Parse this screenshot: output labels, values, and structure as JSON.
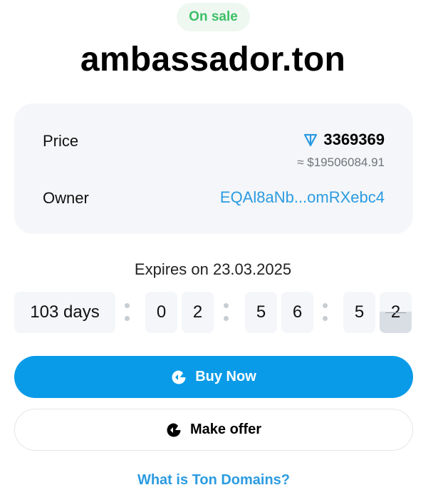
{
  "badge": {
    "label": "On sale",
    "color": "#3dbf67"
  },
  "domain": {
    "name": "ambassador.ton"
  },
  "details": {
    "price_label": "Price",
    "price_icon": "ton-icon",
    "price_value": "3369369",
    "price_usd": "≈ $19506084.91",
    "owner_label": "Owner",
    "owner_address": "EQAl8aNb...omRXebc4",
    "link_color": "#2b9be1"
  },
  "expiry": {
    "text": "Expires on 23.03.2025",
    "countdown": {
      "days": "103 days",
      "hours": [
        "0",
        "2"
      ],
      "minutes": [
        "5",
        "6"
      ],
      "seconds": [
        "5",
        "2"
      ]
    }
  },
  "actions": {
    "buy_label": "Buy Now",
    "buy_icon": "getgems-logo-icon",
    "buy_color": "#0a9be8",
    "offer_label": "Make offer",
    "offer_icon": "getgems-logo-icon"
  },
  "footer": {
    "link_label": "What is Ton Domains?"
  }
}
